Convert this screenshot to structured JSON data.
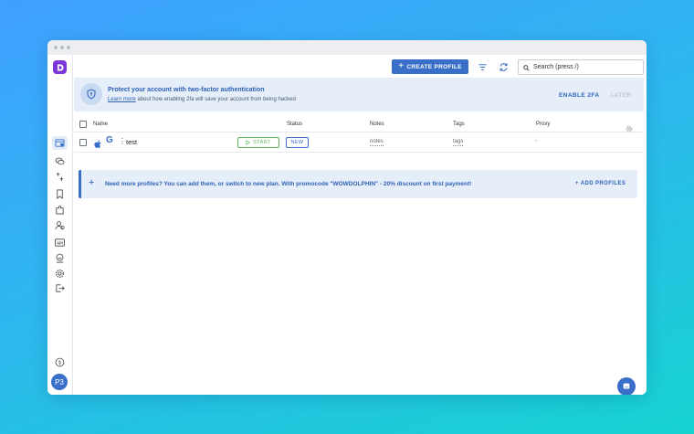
{
  "toolbar": {
    "create_profile_label": "CREATE PROFILE",
    "search_placeholder": "Search (press /)"
  },
  "banner": {
    "title": "Protect your account with two-factor authentication",
    "learn_more": "Learn more",
    "subtitle_rest": " about how enabling 2fa will save your account from being hacked",
    "enable_label": "ENABLE 2FA",
    "later_label": "LATER"
  },
  "table": {
    "columns": {
      "name": "Name",
      "status": "Status",
      "notes": "Notes",
      "tags": "Tags",
      "proxy": "Proxy"
    },
    "rows": [
      {
        "name": "test",
        "start_label": "START",
        "status": "NEW",
        "notes": "notes",
        "tags": "tags",
        "proxy": "-"
      }
    ]
  },
  "promo": {
    "text": "Need more profiles? You can add them, or switch to new plan. With promocode \"WOWDOLPHIN\" - 20% discount on first payment!",
    "add_label": "+ ADD PROFILES"
  },
  "user": {
    "initials": "P3"
  },
  "colors": {
    "accent": "#3a6fc9",
    "brand": "#7b35d8",
    "start_green": "#5cb85c",
    "banner_bg": "#e5eef9"
  },
  "icons": {
    "sidebar": [
      "browser-profiles-icon",
      "chat-icon",
      "automation-icon",
      "bookmark-icon",
      "extensions-icon",
      "users-icon",
      "api-icon",
      "remote-icon",
      "settings-icon",
      "logout-icon",
      "billing-icon"
    ],
    "toolbar": [
      "plus-icon",
      "filter-icon",
      "sync-icon",
      "search-icon"
    ]
  }
}
